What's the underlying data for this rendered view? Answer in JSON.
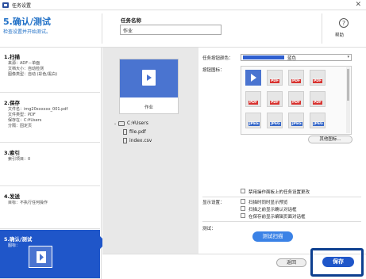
{
  "window": {
    "title": "任务设置",
    "close_glyph": "✕"
  },
  "header": {
    "heading": "5.确认/测试",
    "subtitle": "检查设置并开始测试。",
    "task_name_label": "任务名称",
    "task_name_value": "作业",
    "help_glyph": "?",
    "help_label": "帮助"
  },
  "sidebar": {
    "steps": [
      {
        "title": "1.扫描",
        "details": [
          "来源：ADF－单面",
          "文档大小：自动检测",
          "图像类型：自动 (彩色/黑白)"
        ]
      },
      {
        "title": "2.保存",
        "details": [
          "文件名：img20xxxxxx_001.pdf",
          "文件类型：PDF",
          "保存在：C:¥Users",
          "分隔：固定页"
        ]
      },
      {
        "title": "3.索引",
        "details": [
          "索引项目：0"
        ]
      },
      {
        "title": "4.发送",
        "details": [
          "目标：不执行任何操作"
        ]
      },
      {
        "title": "5.确认/测试",
        "details": [
          "图标："
        ]
      }
    ]
  },
  "preview": {
    "label": "作业",
    "tree": [
      {
        "caret": "⌄",
        "kind": "folder",
        "text": "C:¥Users"
      },
      {
        "caret": "",
        "kind": "file",
        "text": "file.pdf"
      },
      {
        "caret": "",
        "kind": "file",
        "text": "index.csv"
      }
    ]
  },
  "settings": {
    "color_label": "任务按钮颜色：",
    "color_value": "蓝色",
    "color_caret": "▾",
    "icon_label": "按钮图标：",
    "icons": [
      {
        "kind": "play",
        "tag": ""
      },
      {
        "kind": "doc",
        "tag": "PDF"
      },
      {
        "kind": "doc",
        "tag": "PDF"
      },
      {
        "kind": "doc",
        "tag": "PDF"
      },
      {
        "kind": "doc",
        "tag": "PDF"
      },
      {
        "kind": "doc",
        "tag": "PDF"
      },
      {
        "kind": "doc",
        "tag": "PDF"
      },
      {
        "kind": "doc",
        "tag": "PDF"
      },
      {
        "kind": "doc",
        "tag": "JPEG"
      },
      {
        "kind": "doc",
        "tag": "JPEG"
      },
      {
        "kind": "doc",
        "tag": "JPEG"
      },
      {
        "kind": "doc",
        "tag": "JPEG"
      }
    ],
    "other_icons_label": "其他图标...",
    "disable_label": "禁用操作面板上的任务设置更改",
    "display_label": "显示设置：",
    "display_options": [
      "扫描时同时显示预览",
      "扫描之前显示确认对话框",
      "在保存前显示编辑页面对话框"
    ],
    "test_label": "测试：",
    "test_button": "测试扫描"
  },
  "footer": {
    "back_label": "返回",
    "save_label": "保存"
  }
}
